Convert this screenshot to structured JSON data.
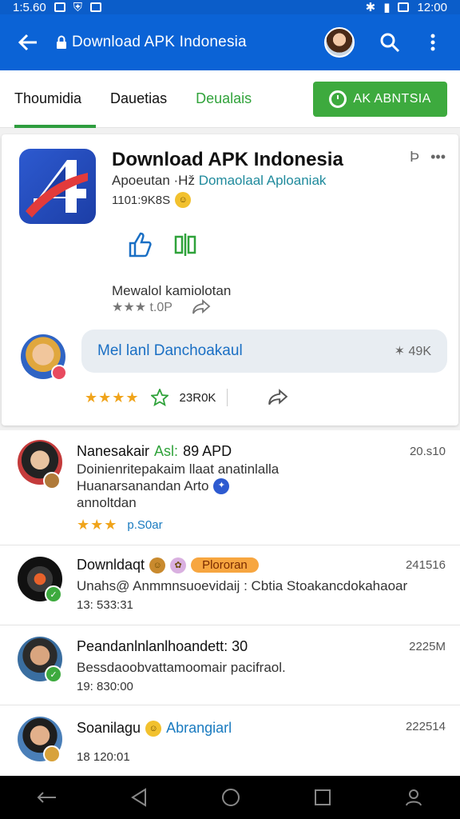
{
  "status_bar": {
    "time": "1:5.60",
    "clock": "12:00"
  },
  "app_bar": {
    "title": "Download APK Indonesia"
  },
  "tabs": [
    {
      "label": "Thoumidia"
    },
    {
      "label": "Dauetias"
    },
    {
      "label": "Deualais"
    }
  ],
  "install_button": {
    "label": "AK ABNTSIA"
  },
  "app": {
    "name": "Download APK Indonesia",
    "dev_prefix": "Apoeutan ·Hž",
    "dev_link": "Domaolaal Aploaniak",
    "meta": "1101:9K8S",
    "description": "Mewalol kamiolotan",
    "rating_text": "★★★ t.0P",
    "user_search_label": "Mel lanl Danchoakaul",
    "user_search_count": "✶ 49K",
    "stats_stars": "★★★★",
    "stats_count": "23R0K"
  },
  "list": [
    {
      "title": "Nanesakair",
      "title_green": "Asl:",
      "title_rest": "89 APD",
      "text1": "Doinienritepakaim llaat anatinlalla",
      "text2": "Huanarsanandan Arto",
      "text3": "annoltdan",
      "meta": "p.S0ar",
      "stars": "★★★",
      "side": "20.s10"
    },
    {
      "title": "Downldaqt",
      "tag": "Plororan",
      "text1": "Unahs@ Anmmnsuoevidaĳ : Cbtia Stoakancdokahaoar",
      "meta": "13: 533:31",
      "side": "241516"
    },
    {
      "title": "Peandanlnlanlhoandett: 30",
      "text1": "Bessdaoobvattamoomair pacifraol.",
      "meta": "19: 830:00",
      "side": "2225M"
    },
    {
      "title": "Soanilagu",
      "title_blue": "Abrangiarl",
      "meta": "18 120:01",
      "side": "222514"
    }
  ],
  "colors": {
    "primary": "#0b63d6",
    "accent_green": "#3daa3e",
    "star": "#f0a41b"
  }
}
